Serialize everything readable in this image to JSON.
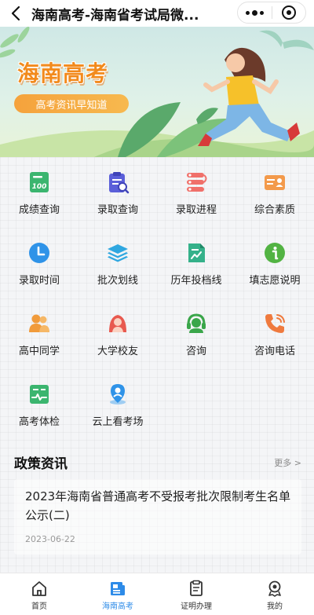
{
  "navbar": {
    "title": "海南高考-海南省考试局微..."
  },
  "banner": {
    "title": "海南高考",
    "subtitle": "高考资讯早知道"
  },
  "menu": [
    {
      "label": "成绩查询",
      "icon": "score-board-icon"
    },
    {
      "label": "录取查询",
      "icon": "clipboard-search-icon"
    },
    {
      "label": "录取进程",
      "icon": "progress-steps-icon"
    },
    {
      "label": "综合素质",
      "icon": "id-card-icon"
    },
    {
      "label": "录取时间",
      "icon": "clock-icon"
    },
    {
      "label": "批次划线",
      "icon": "layers-icon"
    },
    {
      "label": "历年投档线",
      "icon": "chart-document-icon"
    },
    {
      "label": "填志愿说明",
      "icon": "info-icon"
    },
    {
      "label": "高中同学",
      "icon": "people-icon"
    },
    {
      "label": "大学校友",
      "icon": "alumni-icon"
    },
    {
      "label": "咨询",
      "icon": "headset-icon"
    },
    {
      "label": "咨询电话",
      "icon": "phone-icon"
    },
    {
      "label": "高考体检",
      "icon": "medical-report-icon"
    },
    {
      "label": "云上看考场",
      "icon": "location-pin-icon"
    }
  ],
  "news": {
    "section_title": "政策资讯",
    "more_label": "更多 >",
    "items": [
      {
        "title": "2023年海南省普通高考不受报考批次限制考生名单公示(二)",
        "date": "2023-06-22"
      }
    ]
  },
  "tabbar": {
    "items": [
      {
        "label": "首页",
        "icon": "home-icon",
        "active": false
      },
      {
        "label": "海南高考",
        "icon": "news-icon",
        "active": true
      },
      {
        "label": "证明办理",
        "icon": "certificate-icon",
        "active": false
      },
      {
        "label": "我的",
        "icon": "profile-icon",
        "active": false
      }
    ]
  },
  "colors": {
    "accent": "#2d8be8",
    "banner_title": "#f28a1c"
  }
}
